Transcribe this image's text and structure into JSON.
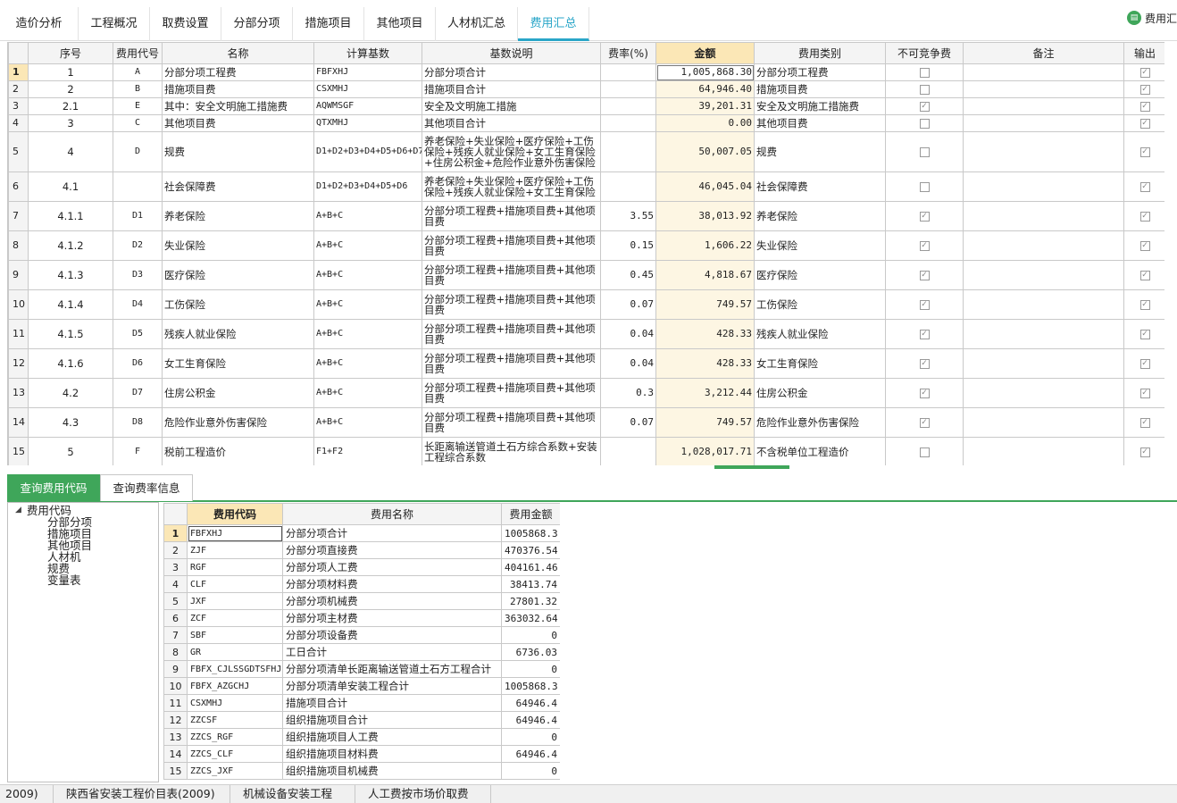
{
  "top_tabs": [
    "造价分析",
    "工程概况",
    "取费设置",
    "分部分项",
    "措施项目",
    "其他项目",
    "人材机汇总",
    "费用汇总"
  ],
  "active_tab_index": 7,
  "side_button": {
    "label": "费用汇",
    "icon": "book-icon"
  },
  "fee_table": {
    "headers": [
      "序号",
      "费用代号",
      "名称",
      "计算基数",
      "基数说明",
      "费率(%)",
      "金额",
      "费用类别",
      "不可竞争费",
      "备注",
      "输出"
    ],
    "rows": [
      {
        "rn": "1",
        "seq": "1",
        "code": "A",
        "name": "分部分项工程费",
        "base": "FBFXHJ",
        "desc": "分部分项合计",
        "rate": "",
        "amount": "1,005,868.30",
        "category": "分部分项工程费",
        "noncomp": false,
        "remark": "",
        "output": true
      },
      {
        "rn": "2",
        "seq": "2",
        "code": "B",
        "name": "措施项目费",
        "base": "CSXMHJ",
        "desc": "措施项目合计",
        "rate": "",
        "amount": "64,946.40",
        "category": "措施项目费",
        "noncomp": false,
        "remark": "",
        "output": true
      },
      {
        "rn": "3",
        "seq": "2.1",
        "code": "E",
        "name": "其中：安全文明施工措施费",
        "base": "AQWMSGF",
        "desc": "安全及文明施工措施",
        "rate": "",
        "amount": "39,201.31",
        "category": "安全及文明施工措施费",
        "noncomp": true,
        "remark": "",
        "output": true
      },
      {
        "rn": "4",
        "seq": "3",
        "code": "C",
        "name": "其他项目费",
        "base": "QTXMHJ",
        "desc": "其他项目合计",
        "rate": "",
        "amount": "0.00",
        "category": "其他项目费",
        "noncomp": false,
        "remark": "",
        "output": true
      },
      {
        "rn": "5",
        "seq": "4",
        "code": "D",
        "name": "规费",
        "base": "D1+D2+D3+D4+D5+D6+D7+D8",
        "desc": "养老保险+失业保险+医疗保险+工伤保险+残疾人就业保险+女工生育保险+住房公积金+危险作业意外伤害保险",
        "rate": "",
        "amount": "50,007.05",
        "category": "规费",
        "noncomp": false,
        "remark": "",
        "output": true
      },
      {
        "rn": "6",
        "seq": "4.1",
        "code": "",
        "name": "社会保障费",
        "base": "D1+D2+D3+D4+D5+D6",
        "desc": "养老保险+失业保险+医疗保险+工伤保险+残疾人就业保险+女工生育保险",
        "rate": "",
        "amount": "46,045.04",
        "category": "社会保障费",
        "noncomp": false,
        "remark": "",
        "output": true
      },
      {
        "rn": "7",
        "seq": "4.1.1",
        "code": "D1",
        "name": "养老保险",
        "base": "A+B+C",
        "desc": "分部分项工程费+措施项目费+其他项目费",
        "rate": "3.55",
        "amount": "38,013.92",
        "category": "养老保险",
        "noncomp": true,
        "remark": "",
        "output": true
      },
      {
        "rn": "8",
        "seq": "4.1.2",
        "code": "D2",
        "name": "失业保险",
        "base": "A+B+C",
        "desc": "分部分项工程费+措施项目费+其他项目费",
        "rate": "0.15",
        "amount": "1,606.22",
        "category": "失业保险",
        "noncomp": true,
        "remark": "",
        "output": true
      },
      {
        "rn": "9",
        "seq": "4.1.3",
        "code": "D3",
        "name": "医疗保险",
        "base": "A+B+C",
        "desc": "分部分项工程费+措施项目费+其他项目费",
        "rate": "0.45",
        "amount": "4,818.67",
        "category": "医疗保险",
        "noncomp": true,
        "remark": "",
        "output": true
      },
      {
        "rn": "10",
        "seq": "4.1.4",
        "code": "D4",
        "name": "工伤保险",
        "base": "A+B+C",
        "desc": "分部分项工程费+措施项目费+其他项目费",
        "rate": "0.07",
        "amount": "749.57",
        "category": "工伤保险",
        "noncomp": true,
        "remark": "",
        "output": true
      },
      {
        "rn": "11",
        "seq": "4.1.5",
        "code": "D5",
        "name": "残疾人就业保险",
        "base": "A+B+C",
        "desc": "分部分项工程费+措施项目费+其他项目费",
        "rate": "0.04",
        "amount": "428.33",
        "category": "残疾人就业保险",
        "noncomp": true,
        "remark": "",
        "output": true
      },
      {
        "rn": "12",
        "seq": "4.1.6",
        "code": "D6",
        "name": "女工生育保险",
        "base": "A+B+C",
        "desc": "分部分项工程费+措施项目费+其他项目费",
        "rate": "0.04",
        "amount": "428.33",
        "category": "女工生育保险",
        "noncomp": true,
        "remark": "",
        "output": true
      },
      {
        "rn": "13",
        "seq": "4.2",
        "code": "D7",
        "name": "住房公积金",
        "base": "A+B+C",
        "desc": "分部分项工程费+措施项目费+其他项目费",
        "rate": "0.3",
        "amount": "3,212.44",
        "category": "住房公积金",
        "noncomp": true,
        "remark": "",
        "output": true
      },
      {
        "rn": "14",
        "seq": "4.3",
        "code": "D8",
        "name": "危险作业意外伤害保险",
        "base": "A+B+C",
        "desc": "分部分项工程费+措施项目费+其他项目费",
        "rate": "0.07",
        "amount": "749.57",
        "category": "危险作业意外伤害保险",
        "noncomp": true,
        "remark": "",
        "output": true
      },
      {
        "rn": "15",
        "seq": "5",
        "code": "F",
        "name": "税前工程造价",
        "base": "F1+F2",
        "desc": "长距离输送管道土石方综合系数+安装工程综合系数",
        "rate": "",
        "amount": "1,028,017.71",
        "category": "不含税单位工程造价",
        "noncomp": false,
        "remark": "",
        "output": true
      }
    ]
  },
  "bottom_tabs": [
    "查询费用代码",
    "查询费率信息"
  ],
  "tree": {
    "root": "费用代码",
    "children": [
      "分部分项",
      "措施项目",
      "其他项目",
      "人材机",
      "规费",
      "变量表"
    ]
  },
  "code_table": {
    "headers": [
      "费用代码",
      "费用名称",
      "费用金额"
    ],
    "rows": [
      {
        "rn": "1",
        "code": "FBFXHJ",
        "name": "分部分项合计",
        "amount": "1005868.3"
      },
      {
        "rn": "2",
        "code": "ZJF",
        "name": "分部分项直接费",
        "amount": "470376.54"
      },
      {
        "rn": "3",
        "code": "RGF",
        "name": "分部分项人工费",
        "amount": "404161.46"
      },
      {
        "rn": "4",
        "code": "CLF",
        "name": "分部分项材料费",
        "amount": "38413.74"
      },
      {
        "rn": "5",
        "code": "JXF",
        "name": "分部分项机械费",
        "amount": "27801.32"
      },
      {
        "rn": "6",
        "code": "ZCF",
        "name": "分部分项主材费",
        "amount": "363032.64"
      },
      {
        "rn": "7",
        "code": "SBF",
        "name": "分部分项设备费",
        "amount": "0"
      },
      {
        "rn": "8",
        "code": "GR",
        "name": "工日合计",
        "amount": "6736.03"
      },
      {
        "rn": "9",
        "code": "FBFX_CJLSSGDTSFHJ",
        "name": "分部分项清单长距离输送管道土石方工程合计",
        "amount": "0"
      },
      {
        "rn": "10",
        "code": "FBFX_AZGCHJ",
        "name": "分部分项清单安装工程合计",
        "amount": "1005868.3"
      },
      {
        "rn": "11",
        "code": "CSXMHJ",
        "name": "措施项目合计",
        "amount": "64946.4"
      },
      {
        "rn": "12",
        "code": "ZZCSF",
        "name": "组织措施项目合计",
        "amount": "64946.4"
      },
      {
        "rn": "13",
        "code": "ZZCS_RGF",
        "name": "组织措施项目人工费",
        "amount": "0"
      },
      {
        "rn": "14",
        "code": "ZZCS_CLF",
        "name": "组织措施项目材料费",
        "amount": "64946.4"
      },
      {
        "rn": "15",
        "code": "ZZCS_JXF",
        "name": "组织措施项目机械费",
        "amount": "0"
      }
    ]
  },
  "status_bar": [
    "2009)",
    "陕西省安装工程价目表(2009)",
    "机械设备安装工程",
    "人工费按市场价取费"
  ],
  "colors": {
    "accent": "#2aa6c8",
    "green": "#3fa65a",
    "highlight": "#fbe7b6"
  }
}
